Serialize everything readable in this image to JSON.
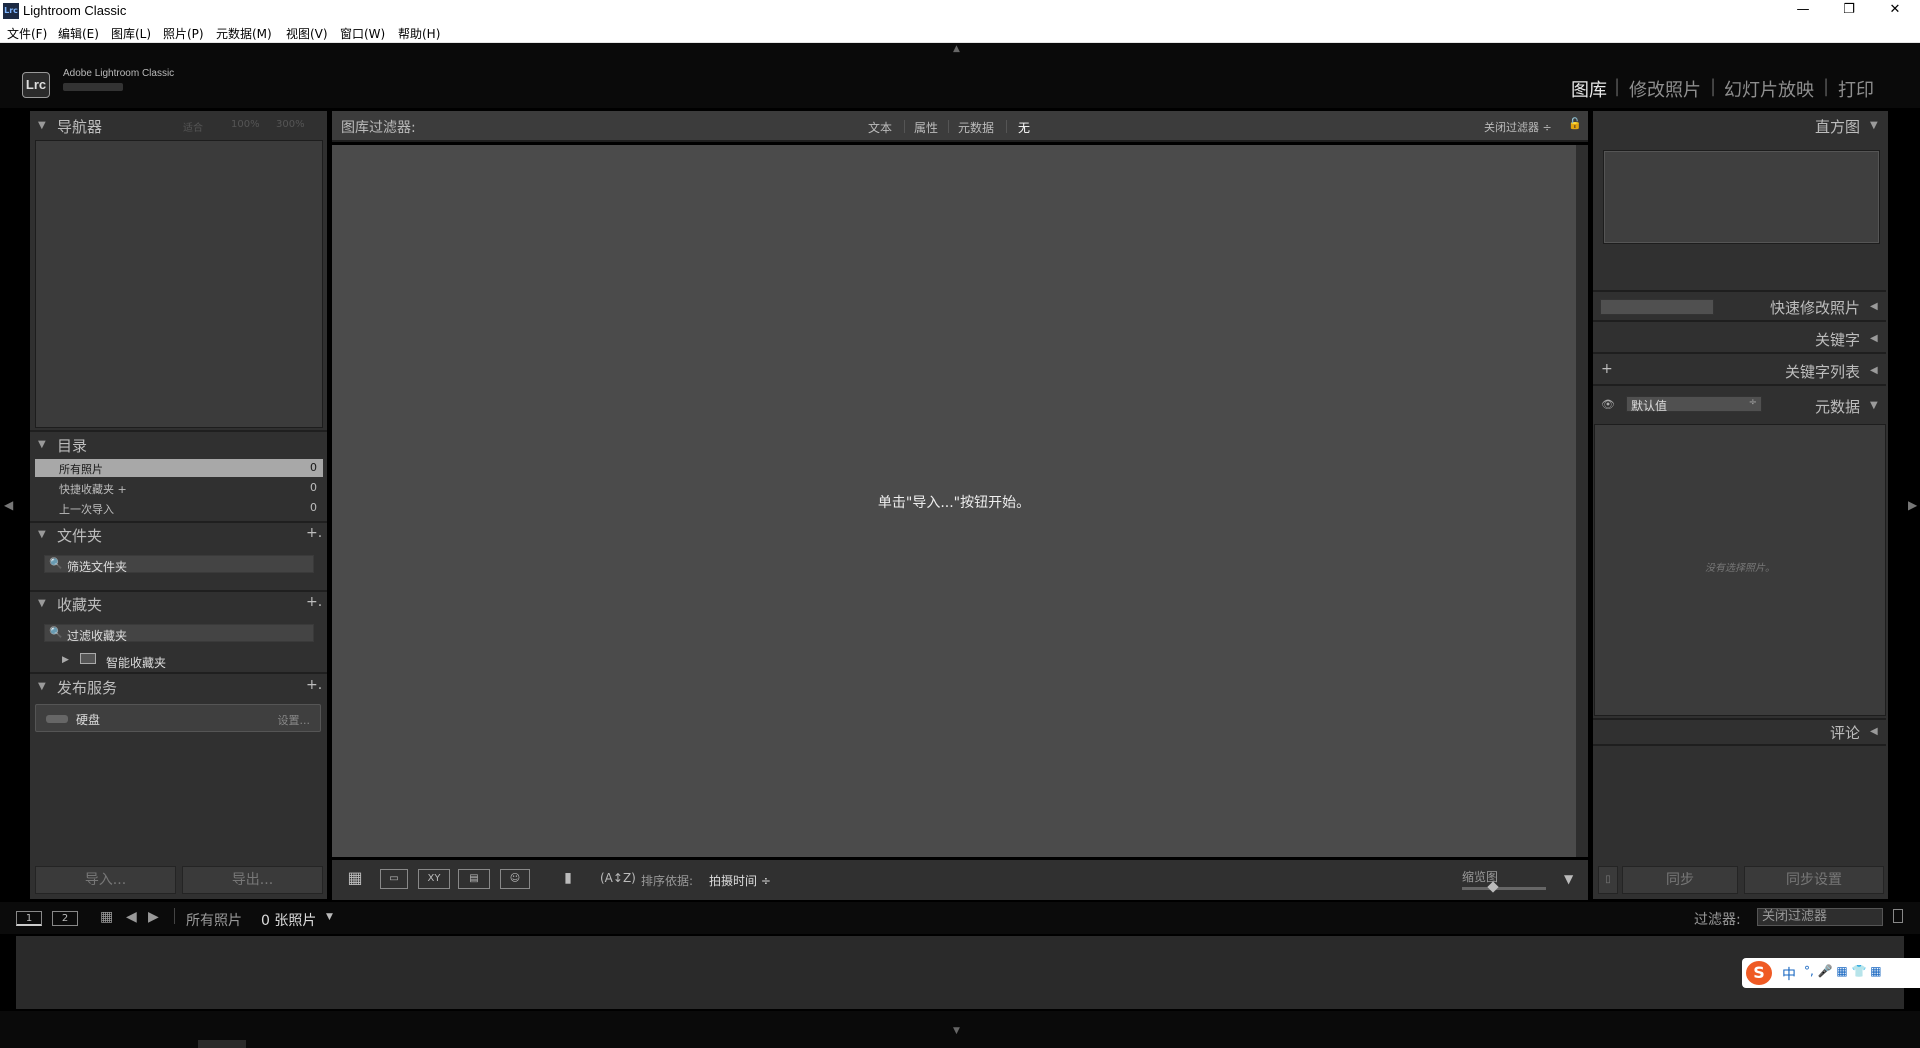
{
  "window": {
    "title": "Lightroom Classic",
    "icon_text": "Lrc",
    "minimize": "—",
    "maximize": "❐",
    "close": "✕"
  },
  "menu": [
    "文件(F)",
    "编辑(E)",
    "图库(L)",
    "照片(P)",
    "元数据(M)",
    "视图(V)",
    "窗口(W)",
    "帮助(H)"
  ],
  "brand": {
    "logo": "Lrc",
    "name": "Adobe Lightroom Classic"
  },
  "modules": [
    "图库",
    "修改照片",
    "幻灯片放映",
    "打印"
  ],
  "active_module": "图库",
  "left": {
    "navigator": {
      "title": "导航器",
      "zoom": [
        "适合",
        "100%",
        "300%"
      ]
    },
    "catalog": {
      "title": "目录",
      "rows": [
        {
          "label": "所有照片",
          "count": "0"
        },
        {
          "label": "快捷收藏夹 +",
          "count": "0"
        },
        {
          "label": "上一次导入",
          "count": "0"
        }
      ]
    },
    "folders": {
      "title": "文件夹",
      "add": "+.",
      "search": "筛选文件夹"
    },
    "collections": {
      "title": "收藏夹",
      "add": "+.",
      "search": "过滤收藏夹",
      "smart": "智能收藏夹"
    },
    "publish": {
      "title": "发布服务",
      "add": "+.",
      "service": "硬盘",
      "settings": "设置..."
    },
    "import_btn": "导入...",
    "export_btn": "导出..."
  },
  "filter": {
    "title": "图库过滤器:",
    "tabs": [
      "文本",
      "属性",
      "元数据",
      "无"
    ],
    "active_tab": "无",
    "off": "关闭过滤器 ÷"
  },
  "center": {
    "empty_message": "单击\"导入...\"按钮开始。"
  },
  "toolbar": {
    "sort_label": "排序依据:",
    "sort_value": "拍摄时间 ÷",
    "thumb_label": "缩览图"
  },
  "right": {
    "histogram": "直方图",
    "quick_develop": "快速修改照片",
    "keywording": "关键字",
    "keyword_list": "关键字列表",
    "metadata": "元数据",
    "metadata_preset": "默认值",
    "metadata_empty": "没有选择照片。",
    "comments": "评论",
    "sync_btn": "同步",
    "sync_settings_btn": "同步设置"
  },
  "filmstrip": {
    "page1": "1",
    "page2": "2",
    "path": "所有照片",
    "count": "0 张照片",
    "filter_label": "过滤器:",
    "filter_value": "关闭过滤器"
  },
  "ime": {
    "logo": "S",
    "lang": "中",
    "items": "°, 🎤 ▦ 👕 ▦"
  }
}
